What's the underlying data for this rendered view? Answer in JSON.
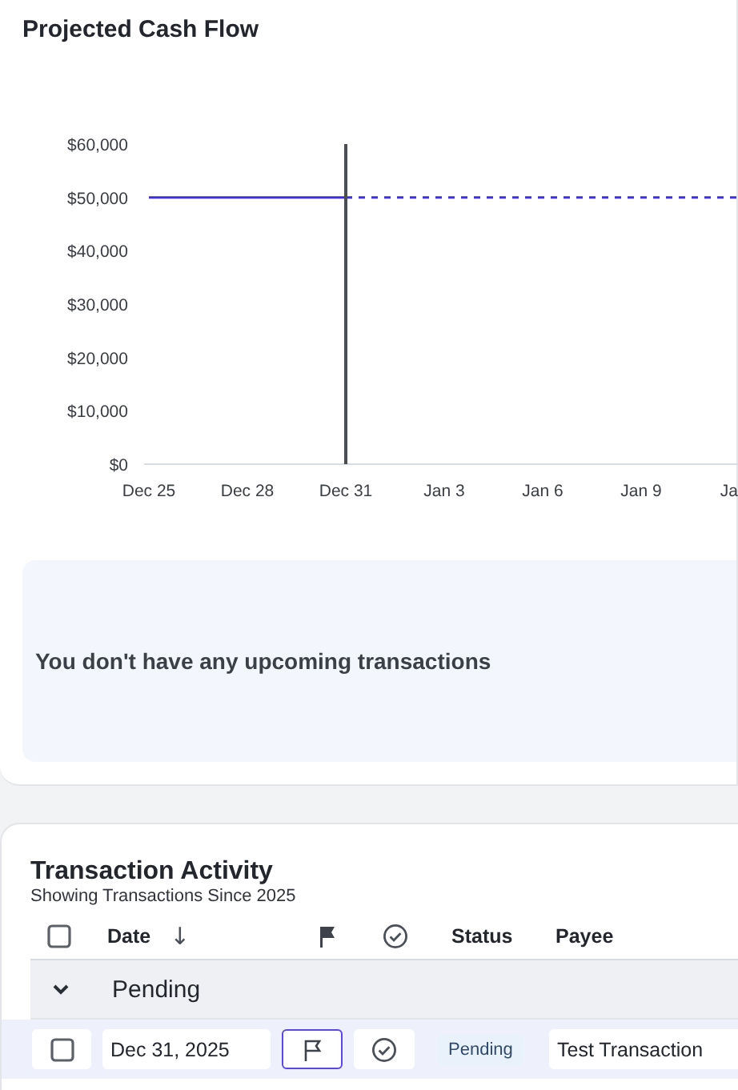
{
  "title": "Projected Cash Flow",
  "chart": {
    "chart_data": {
      "type": "line",
      "categories": [
        "Dec 25",
        null,
        null,
        "Dec 28",
        null,
        null,
        "Dec 31",
        null,
        null,
        "Jan 3",
        null,
        null,
        "Jan 6",
        null,
        null,
        "Jan 9",
        null,
        null,
        "Ja"
      ],
      "ylim": [
        0,
        60000
      ],
      "yticks": [
        {
          "value": 0,
          "label": "$0"
        },
        {
          "value": 10000,
          "label": "$10,000"
        },
        {
          "value": 20000,
          "label": "$20,000"
        },
        {
          "value": 30000,
          "label": "$30,000"
        },
        {
          "value": 40000,
          "label": "$40,000"
        },
        {
          "value": 50000,
          "label": "$50,000"
        },
        {
          "value": 60000,
          "label": "$60,000"
        }
      ],
      "series": [
        {
          "color": "#3b2bf5",
          "values": [
            50000,
            50000,
            50000,
            50000,
            50000,
            50000,
            50000,
            50000,
            50000,
            50000,
            50000,
            50000,
            50000,
            50000,
            50000,
            50000,
            50000,
            50000,
            50000
          ]
        }
      ],
      "annotations": [
        {
          "x": "Dec 31"
        }
      ]
    }
  },
  "empty_state": {
    "message": "You don't have any upcoming transactions"
  },
  "activity": {
    "title": "Transaction Activity",
    "subtitle": "Showing Transactions Since 2025",
    "columns": [
      {
        "kind": "checkbox",
        "checked": false
      },
      {
        "kind": "text",
        "label": "Date",
        "sort_icon": "↓"
      },
      {
        "kind": "flag"
      },
      {
        "kind": "cleared"
      },
      {
        "kind": "text",
        "label": "Status"
      },
      {
        "kind": "text",
        "label": "Payee"
      }
    ],
    "groups": [
      {
        "label": "Pending",
        "expanded": true,
        "rows": [
          {
            "checked": false,
            "date": "Dec 31, 2025",
            "flagged": false,
            "cleared": false,
            "status": "Pending",
            "payee": "Test Transaction"
          }
        ]
      }
    ]
  }
}
